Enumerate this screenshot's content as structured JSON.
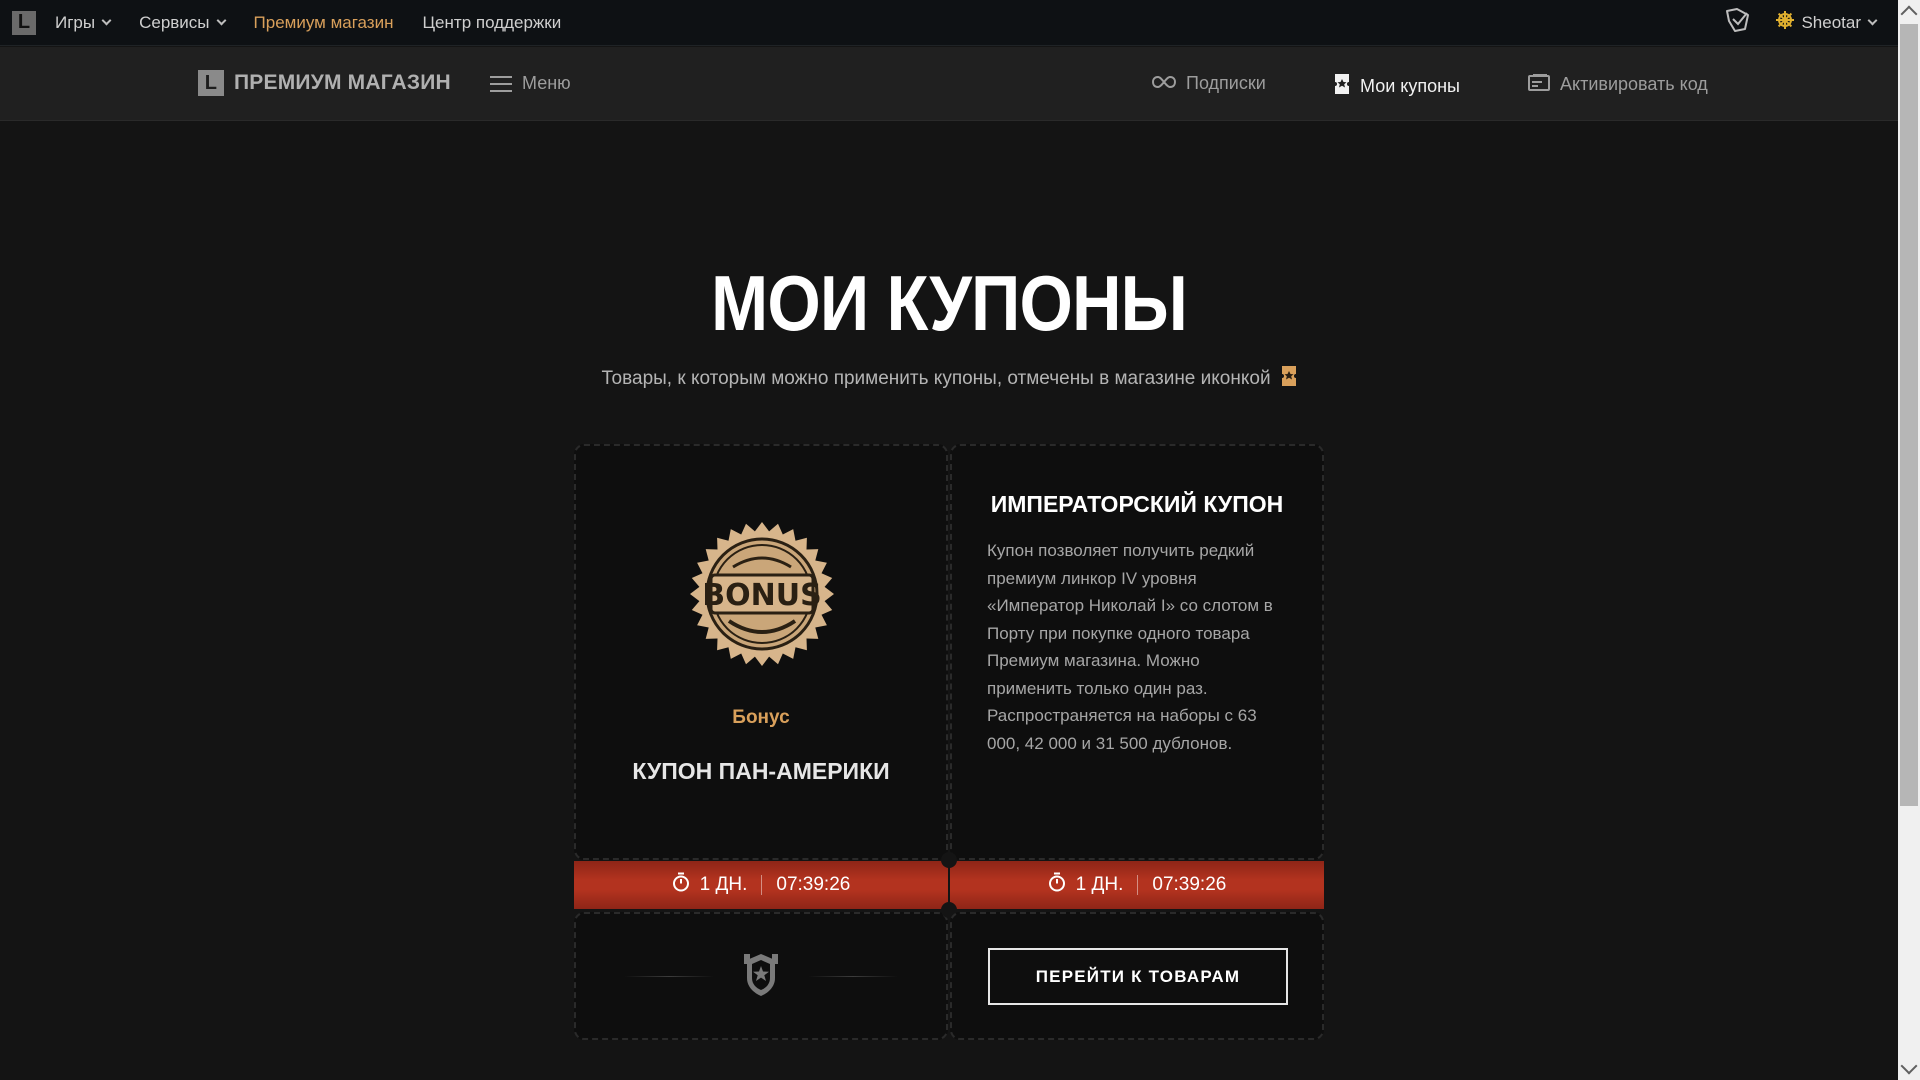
{
  "topbar": {
    "logo_letter": "L",
    "nav": [
      {
        "label": "Игры",
        "dropdown": true
      },
      {
        "label": "Сервисы",
        "dropdown": true
      },
      {
        "label": "Премиум магазин",
        "dropdown": false
      },
      {
        "label": "Центр поддержки",
        "dropdown": false
      }
    ],
    "username": "Sheotar",
    "accent_color": "#d9a05b"
  },
  "subnav": {
    "brand_letter": "L",
    "brand": "ПРЕМИУМ МАГАЗИН",
    "menu": "Меню",
    "links": [
      {
        "label": "Подписки",
        "icon": "infinity-icon"
      },
      {
        "label": "Мои купоны",
        "icon": "coupon-icon",
        "active": true
      },
      {
        "label": "Активировать код",
        "icon": "card-icon"
      }
    ]
  },
  "hero": {
    "title": "МОИ КУПОНЫ",
    "subtitle": "Товары, к которым можно применить купоны, отмечены в магазине иконкой"
  },
  "cards": [
    {
      "badge_text": "BONUS",
      "category": "Бонус",
      "name": "КУПОН ПАН-АМЕРИКИ",
      "timer_days": "1 ДН.",
      "timer_time": "07:39:26",
      "footer_icon": "shield-star-icon"
    },
    {
      "name": "ИМПЕРАТОРСКИЙ КУПОН",
      "description": "Купон позволяет получить редкий премиум линкор IV уровня «Император Николай I» со слотом в Порту при покупке одного товара Премиум магазина. Можно применить только один раз. Распространяется на наборы с 63 000, 42 000 и 31 500 дублонов.",
      "timer_days": "1 ДН.",
      "timer_time": "07:39:26",
      "button": "ПЕРЕЙТИ К ТОВАРАМ"
    }
  ],
  "colors": {
    "timer_red": "#b3331f",
    "gold": "#d9a05b"
  }
}
